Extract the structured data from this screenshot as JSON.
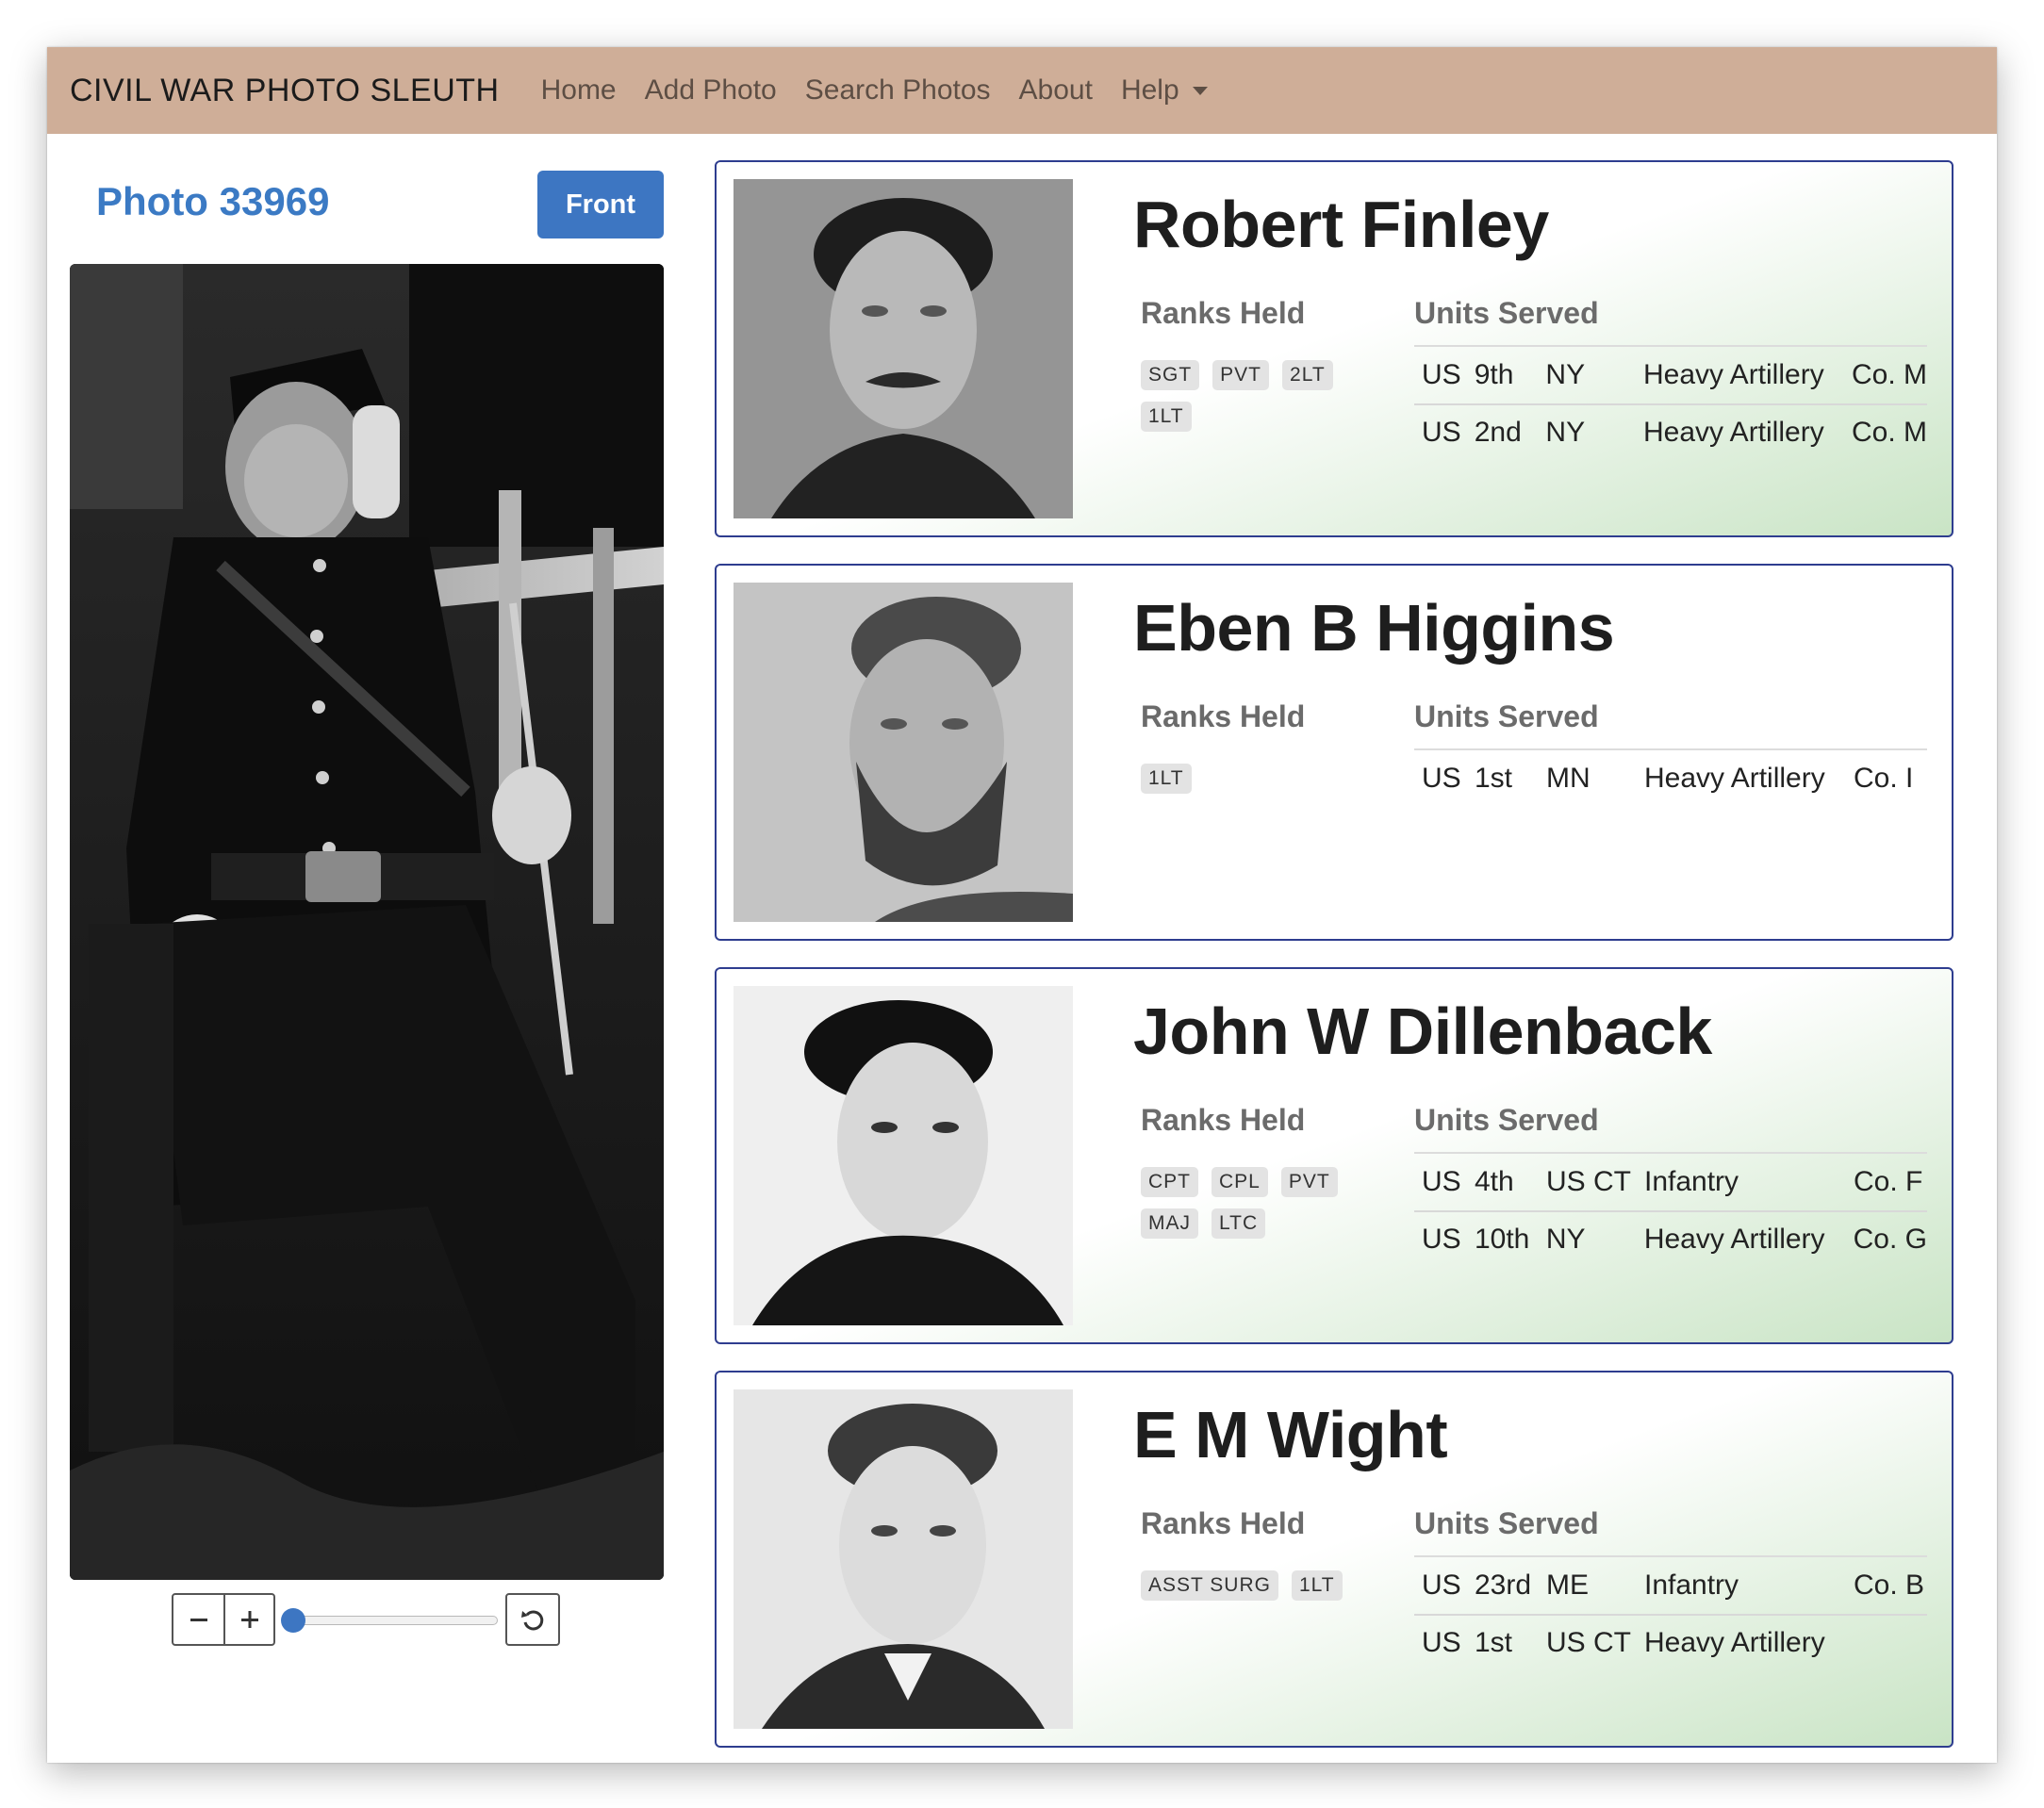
{
  "navbar": {
    "brand": "CIVIL WAR PHOTO SLEUTH",
    "links": [
      "Home",
      "Add Photo",
      "Search Photos",
      "About",
      "Help"
    ]
  },
  "photo": {
    "title": "Photo 33969",
    "side_button": "Front"
  },
  "zoom": {
    "minus_icon": "minus-icon",
    "plus_icon": "plus-icon",
    "reset_icon": "rotate-ccw-icon",
    "level": 0
  },
  "colors": {
    "navbar": "#cfae98",
    "accent": "#3d76c2",
    "card_border": "#2e3d8f",
    "card_gradient": "#c9e4c5"
  },
  "labels": {
    "ranks_held": "Ranks Held",
    "units_served": "Units Served"
  },
  "soldiers": [
    {
      "name": "Robert Finley",
      "ranks": [
        "SGT",
        "PVT",
        "2LT",
        "1LT"
      ],
      "units": [
        [
          "US",
          "9th",
          "NY",
          "Heavy Artillery",
          "Co. M"
        ],
        [
          "US",
          "2nd",
          "NY",
          "Heavy Artillery",
          "Co. M"
        ]
      ]
    },
    {
      "name": "Eben B Higgins",
      "ranks": [
        "1LT"
      ],
      "units": [
        [
          "US",
          "1st",
          "MN",
          "Heavy Artillery",
          "Co. I"
        ]
      ]
    },
    {
      "name": "John W Dillenback",
      "ranks": [
        "CPT",
        "CPL",
        "PVT",
        "MAJ",
        "LTC"
      ],
      "units": [
        [
          "US",
          "4th",
          "US CT",
          "Infantry",
          "Co. F"
        ],
        [
          "US",
          "10th",
          "NY",
          "Heavy Artillery",
          "Co. G"
        ]
      ]
    },
    {
      "name": "E M Wight",
      "ranks": [
        "ASST SURG",
        "1LT"
      ],
      "units": [
        [
          "US",
          "23rd",
          "ME",
          "Infantry",
          "Co. B"
        ],
        [
          "US",
          "1st",
          "US CT",
          "Heavy Artillery",
          ""
        ]
      ]
    }
  ]
}
